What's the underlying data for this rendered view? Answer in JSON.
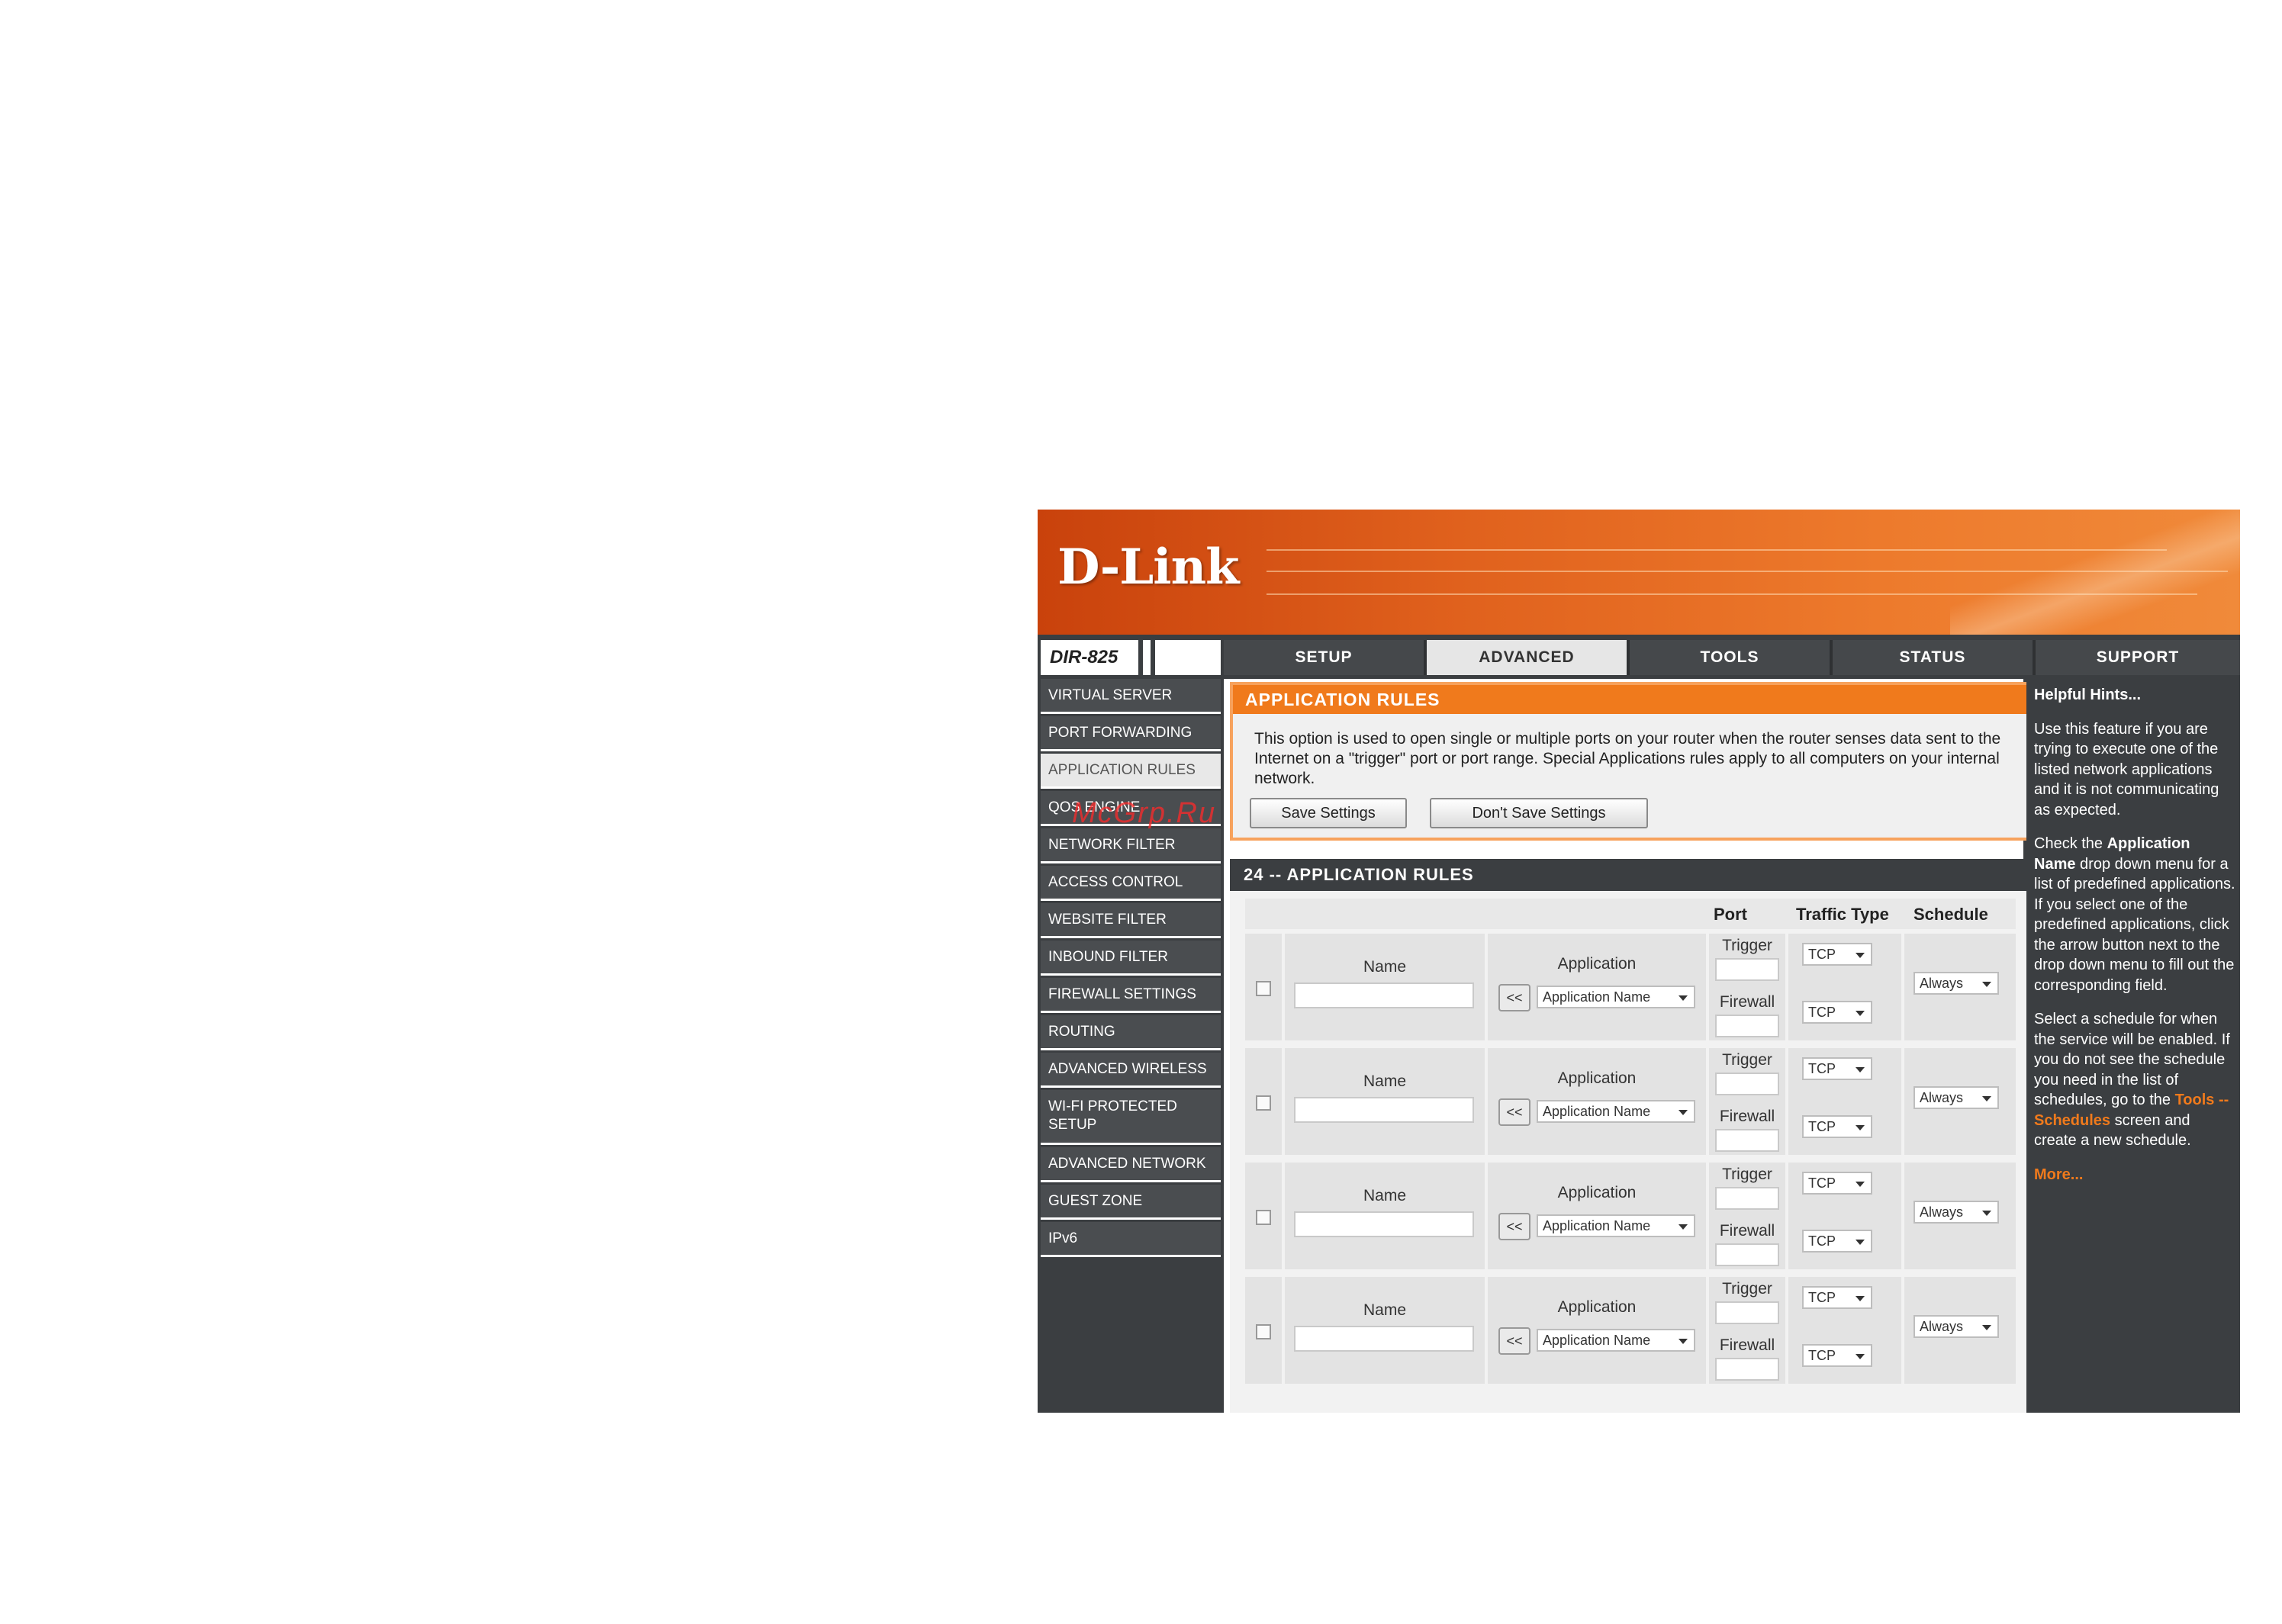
{
  "brand": {
    "logo": "D-Link",
    "model": "DIR-825"
  },
  "tabs": [
    {
      "label": "SETUP"
    },
    {
      "label": "ADVANCED"
    },
    {
      "label": "TOOLS"
    },
    {
      "label": "STATUS"
    },
    {
      "label": "SUPPORT"
    }
  ],
  "sidebar": {
    "items": [
      {
        "label": "VIRTUAL SERVER"
      },
      {
        "label": "PORT FORWARDING"
      },
      {
        "label": "APPLICATION RULES"
      },
      {
        "label": "QOS ENGINE"
      },
      {
        "label": "NETWORK FILTER"
      },
      {
        "label": "ACCESS CONTROL"
      },
      {
        "label": "WEBSITE FILTER"
      },
      {
        "label": "INBOUND FILTER"
      },
      {
        "label": "FIREWALL SETTINGS"
      },
      {
        "label": "ROUTING"
      },
      {
        "label": "ADVANCED WIRELESS"
      },
      {
        "label": "WI-FI PROTECTED SETUP"
      },
      {
        "label": "ADVANCED NETWORK"
      },
      {
        "label": "GUEST ZONE"
      },
      {
        "label": "IPv6"
      }
    ]
  },
  "intro": {
    "title": "APPLICATION RULES",
    "text": "This option is used to open single or multiple ports on your router when the router senses data sent to the Internet on a \"trigger\" port or port range. Special Applications rules apply to all computers on your internal network.",
    "save_label": "Save Settings",
    "dont_save_label": "Don't Save Settings"
  },
  "rules": {
    "title": "24 -- APPLICATION RULES",
    "headers": {
      "port": "Port",
      "traffic": "Traffic Type",
      "schedule": "Schedule"
    },
    "labels": {
      "name": "Name",
      "application": "Application",
      "trigger": "Trigger",
      "firewall": "Firewall",
      "arrow": "<<"
    },
    "rows": [
      {
        "app_select": "Application Name",
        "trigger_type": "TCP",
        "firewall_type": "TCP",
        "schedule": "Always"
      },
      {
        "app_select": "Application Name",
        "trigger_type": "TCP",
        "firewall_type": "TCP",
        "schedule": "Always"
      },
      {
        "app_select": "Application Name",
        "trigger_type": "TCP",
        "firewall_type": "TCP",
        "schedule": "Always"
      },
      {
        "app_select": "Application Name",
        "trigger_type": "TCP",
        "firewall_type": "TCP",
        "schedule": "Always"
      }
    ]
  },
  "help": {
    "title": "Helpful Hints...",
    "p1": "Use this feature if you are trying to execute one of the listed network applications and it is not communicating as expected.",
    "p2_a": "Check the ",
    "p2_b": "Application Name",
    "p2_c": " drop down menu for a list of predefined applications. If you select one of the predefined applications, click the arrow button next to the drop down menu to fill out the corresponding field.",
    "p3_a": "Select a schedule for when the service will be enabled. If you do not see the schedule you need in the list of schedules, go to the ",
    "p3_b": "Tools -- Schedules",
    "p3_c": " screen and create a new schedule.",
    "more": "More..."
  },
  "watermark": "McGrp.Ru"
}
